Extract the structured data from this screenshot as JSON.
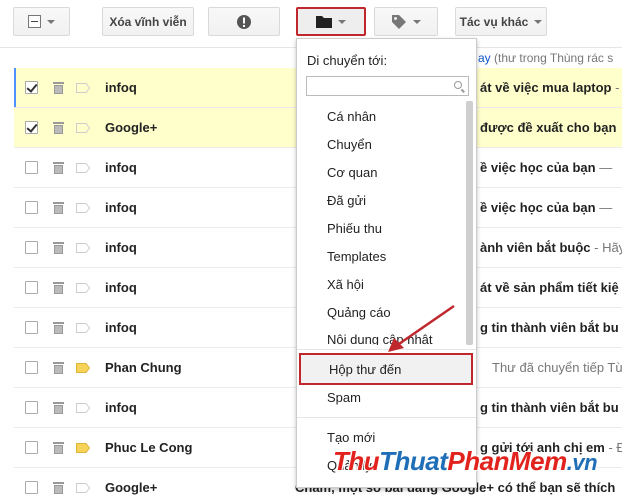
{
  "toolbar": {
    "delete_forever_label": "Xóa vĩnh viễn",
    "more_actions_label": "Tác vụ khác"
  },
  "top_snippet": {
    "link": "ay",
    "text": " (thư trong Thùng rác s"
  },
  "rows": [
    {
      "checked": true,
      "sender": "infoq",
      "subject": "át về việc mua laptop",
      "snippet": " -",
      "important": false
    },
    {
      "checked": true,
      "sender": "Google+",
      "subject": "được đề xuất cho bạn",
      "snippet": "",
      "important": false
    },
    {
      "checked": false,
      "sender": "infoq",
      "subject": "ề việc học của bạn",
      "snippet": " —",
      "important": false
    },
    {
      "checked": false,
      "sender": "infoq",
      "subject": "ề việc học của bạn",
      "snippet": " —",
      "important": false
    },
    {
      "checked": false,
      "sender": "infoq",
      "subject": "ành viên bắt buộc",
      "snippet": " - Hãy",
      "important": false
    },
    {
      "checked": false,
      "sender": "infoq",
      "subject": "át về sản phẩm tiết kiệ",
      "snippet": "",
      "important": false
    },
    {
      "checked": false,
      "sender": "infoq",
      "subject": "g tin thành viên bắt bu",
      "snippet": "",
      "important": false
    },
    {
      "checked": false,
      "sender": "Phan Chung",
      "subject": "",
      "snippet": "Thư đã chuyển tiếp Từ:",
      "important": true
    },
    {
      "checked": false,
      "sender": "infoq",
      "subject": "g tin thành viên bắt bu",
      "snippet": "",
      "important": false
    },
    {
      "checked": false,
      "sender": "Phuc Le Cong",
      "subject": "g gửi tới anh chị em",
      "snippet": " - Đồ",
      "important": true
    },
    {
      "checked": false,
      "sender": "Google+",
      "subject": "Chảm, một số bài đăng Google+ có thể bạn sẽ thích",
      "snippet": "",
      "important": false
    }
  ],
  "move_menu": {
    "title": "Di chuyển tới:",
    "search_placeholder": "",
    "items": [
      "Cá nhân",
      "Chuyển",
      "Cơ quan",
      "Đã gửi",
      "Phiếu thu",
      "Templates",
      "Xã hội",
      "Quảng cáo",
      "Nội dung cập nhật"
    ],
    "highlighted": "Hộp thư đến",
    "after": [
      "Spam"
    ],
    "footer": [
      "Tạo mới",
      "Quản lý"
    ]
  },
  "watermark": {
    "part1": "Thu",
    "part2": "Thuat",
    "part3": "PhanMem",
    "part4": ".vn"
  },
  "colors": {
    "accent_red": "#c0272d",
    "selected_row": "#ffffcc",
    "important_tag": "#f7d359"
  }
}
